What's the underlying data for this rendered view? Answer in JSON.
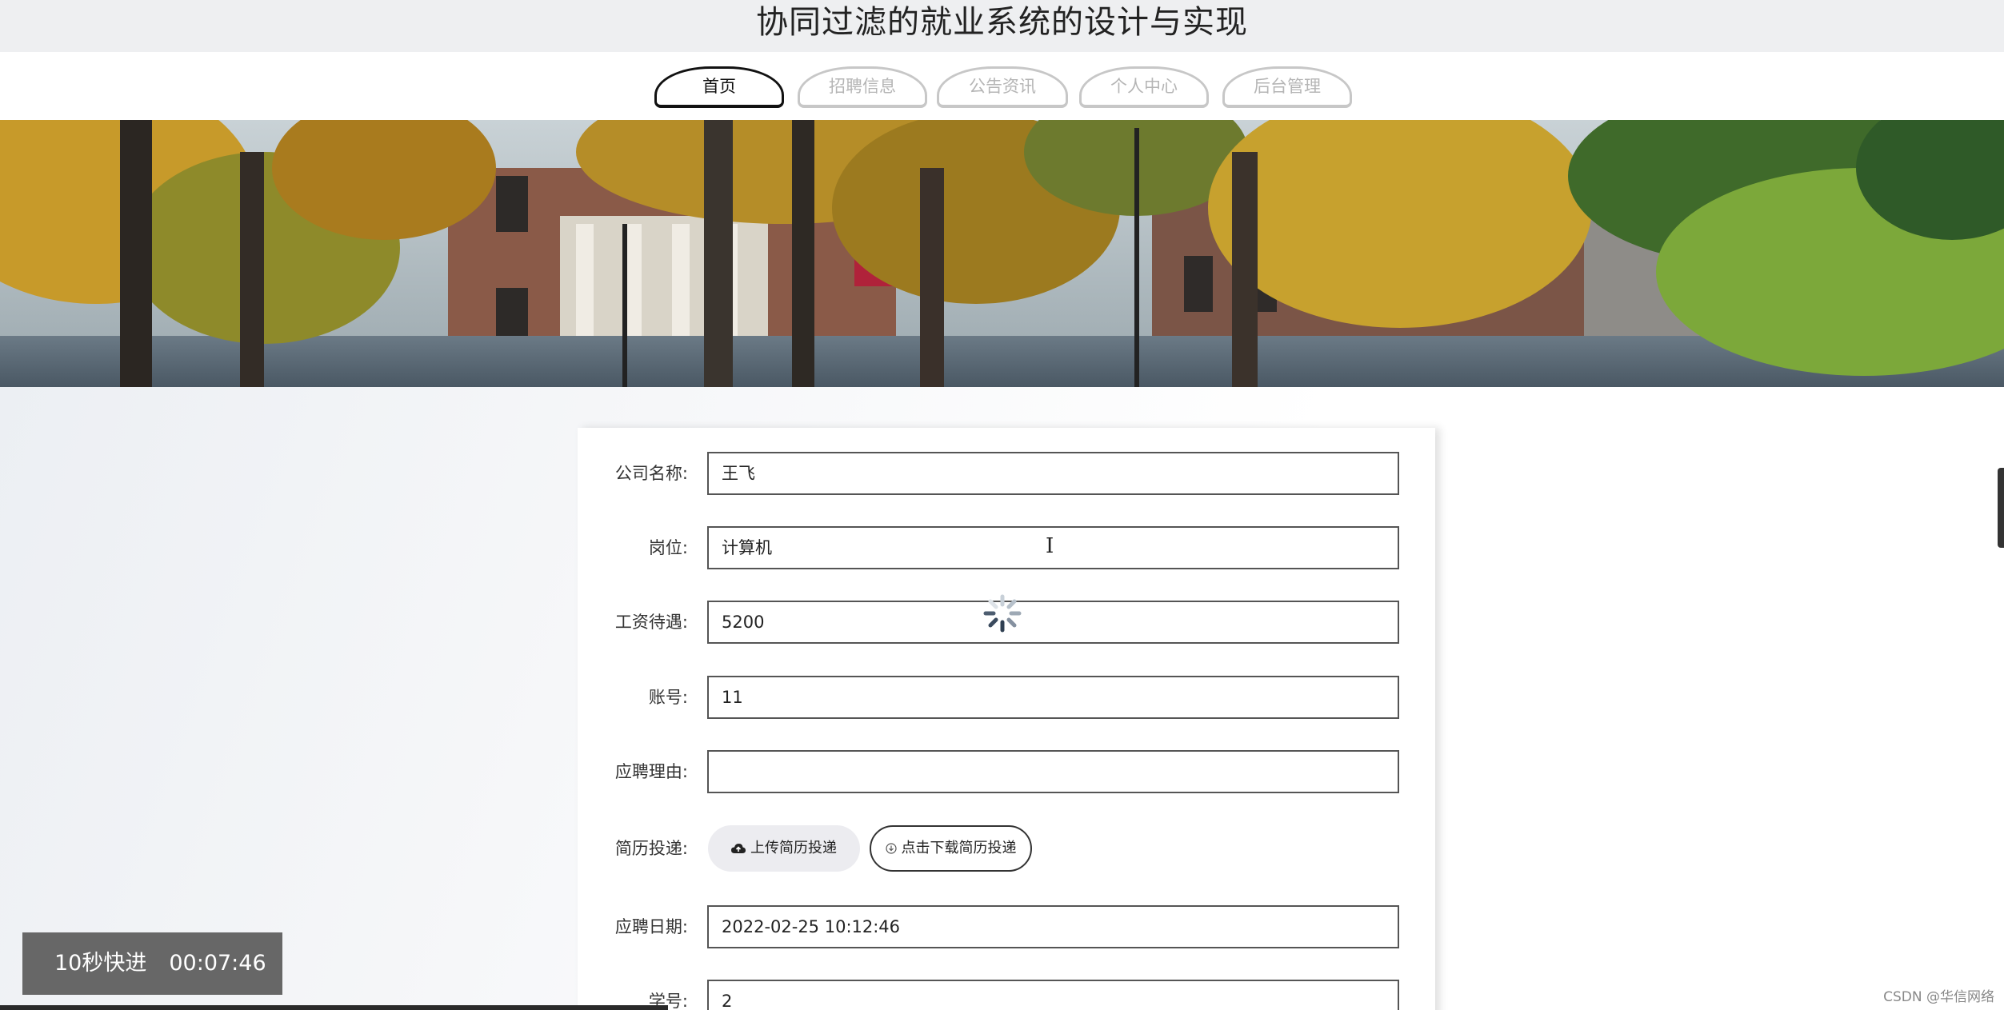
{
  "header": {
    "title": "协同过滤的就业系统的设计与实现"
  },
  "nav": {
    "tabs": [
      {
        "label": "首页",
        "active": true
      },
      {
        "label": "招聘信息",
        "active": false
      },
      {
        "label": "公告资讯",
        "active": false
      },
      {
        "label": "个人中心",
        "active": false
      },
      {
        "label": "后台管理",
        "active": false
      }
    ]
  },
  "form": {
    "company": {
      "label": "公司名称:",
      "value": "王飞"
    },
    "position": {
      "label": "岗位:",
      "value": "计算机"
    },
    "salary": {
      "label": "工资待遇:",
      "value": "5200"
    },
    "account": {
      "label": "账号:",
      "value": "11"
    },
    "reason": {
      "label": "应聘理由:",
      "value": ""
    },
    "resume": {
      "label": "简历投递:",
      "upload_label": "上传简历投递",
      "download_label": "点击下载简历投递"
    },
    "apply_date": {
      "label": "应聘日期:",
      "value": "2022-02-25 10:12:46"
    },
    "student_id": {
      "label": "学号:",
      "value": "2"
    }
  },
  "video": {
    "skip_label": "10秒快进",
    "time": "00:07:46"
  },
  "watermark": "CSDN @华信网络",
  "colors": {
    "active_tab": "#111111",
    "inactive_tab": "#c7c7c7",
    "header_bg": "#eeeff1"
  }
}
